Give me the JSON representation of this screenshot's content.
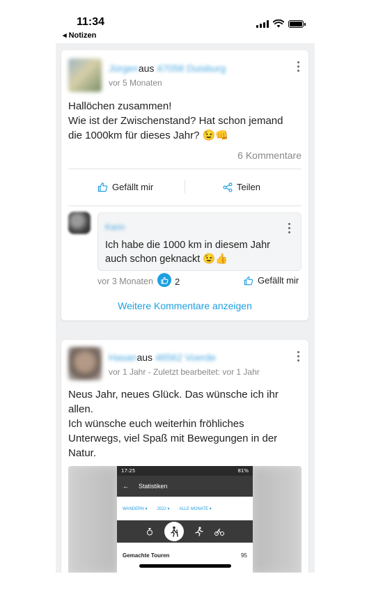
{
  "status_bar": {
    "time": "11:34",
    "back_label": "◂ Notizen"
  },
  "posts": [
    {
      "author": "Jürgen",
      "from_word": "aus",
      "location": "47058 Duisburg",
      "timestamp": "vor 5 Monaten",
      "body_lines": [
        "Hallöchen zusammen!",
        "Wie ist der Zwischenstand? Hat schon jemand",
        "die 1000km für dieses Jahr? 😉👊"
      ],
      "comments_count": "6 Kommentare",
      "like_label": "Gefällt mir",
      "share_label": "Teilen",
      "comment": {
        "author": "Karin",
        "text_lines": [
          "Ich habe die 1000 km in diesem Jahr",
          "auch schon geknackt 😉👍"
        ],
        "timestamp": "vor 3 Monaten",
        "likes": "2",
        "like_label": "Gefällt mir"
      },
      "more_comments_label": "Weitere Kommentare anzeigen"
    },
    {
      "author": "Hasan",
      "from_word": "aus",
      "location": "46562 Voerde",
      "timestamp": "vor 1 Jahr - Zuletzt bearbeitet: vor 1 Jahr",
      "body_lines": [
        "Neus Jahr, neues Glück. Das wünsche ich ihr",
        "allen.",
        "Ich wünsche euch weiterhin fröhliches",
        "Unterwegs, viel Spaß mit Bewegungen in der",
        "Natur."
      ],
      "image": {
        "status_time": "17:25",
        "status_right": "81%",
        "screen_title": "Statistiken",
        "filters": [
          "WANDERN ▾",
          "2022 ▾",
          "ALLE MONATE ▾"
        ],
        "row_label": "Gemachte Touren",
        "row_value": "95"
      }
    }
  ],
  "colors": {
    "accent": "#1d9fe2",
    "muted": "#888888",
    "feed_bg": "#eef0f2"
  }
}
